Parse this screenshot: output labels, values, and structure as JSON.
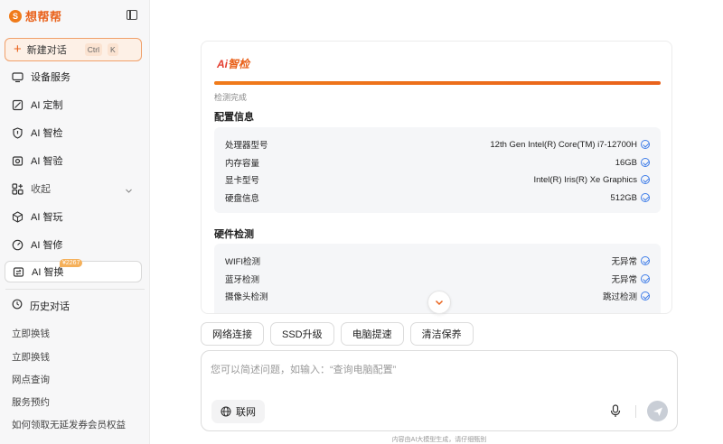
{
  "brand": {
    "name": "想帮帮"
  },
  "sidebar": {
    "new_chat": {
      "label": "新建对话",
      "kbd_ctrl": "Ctrl",
      "kbd_key": "K"
    },
    "items": [
      {
        "label": "设备服务",
        "icon": "monitor-icon"
      },
      {
        "label": "AI 定制",
        "icon": "palette-icon"
      },
      {
        "label": "AI 智检",
        "icon": "shield-icon"
      },
      {
        "label": "AI 智验",
        "icon": "verify-icon"
      },
      {
        "label": "收起",
        "icon": "grid-plus-icon"
      },
      {
        "label": "AI 智玩",
        "icon": "cube-icon"
      },
      {
        "label": "AI 智修",
        "icon": "gauge-icon"
      },
      {
        "label": "AI 智换",
        "icon": "swap-icon",
        "badge": "¥2267"
      }
    ],
    "history_title": "历史对话",
    "history": [
      "立即换钱",
      "立即换钱",
      "网点查询",
      "服务预约",
      "如何领取无延发券会员权益"
    ]
  },
  "panel": {
    "logo_ai": "Ai",
    "logo_text": "智检",
    "progress": 1.0,
    "status": "检测完成",
    "config_title": "配置信息",
    "config": [
      {
        "label": "处理器型号",
        "value": "12th Gen Intel(R) Core(TM) i7-12700H"
      },
      {
        "label": "内存容量",
        "value": "16GB"
      },
      {
        "label": "显卡型号",
        "value": "Intel(R) Iris(R) Xe Graphics"
      },
      {
        "label": "硬盘信息",
        "value": "512GB"
      }
    ],
    "hw_title": "硬件检测",
    "hardware": [
      {
        "label": "WIFI检测",
        "value": "无异常"
      },
      {
        "label": "蓝牙检测",
        "value": "无异常"
      },
      {
        "label": "摄像头检测",
        "value": "跳过检测"
      }
    ]
  },
  "chips": [
    "网络连接",
    "SSD升级",
    "电脑提速",
    "清洁保养"
  ],
  "composer": {
    "placeholder": "您可以简述问题，如输入：“查询电脑配置”",
    "net_label": "联网"
  },
  "disclaimer": "内容由AI大模型生成，请仔细甄别",
  "colors": {
    "accent": "#e9621b",
    "check": "#3f7de8"
  }
}
